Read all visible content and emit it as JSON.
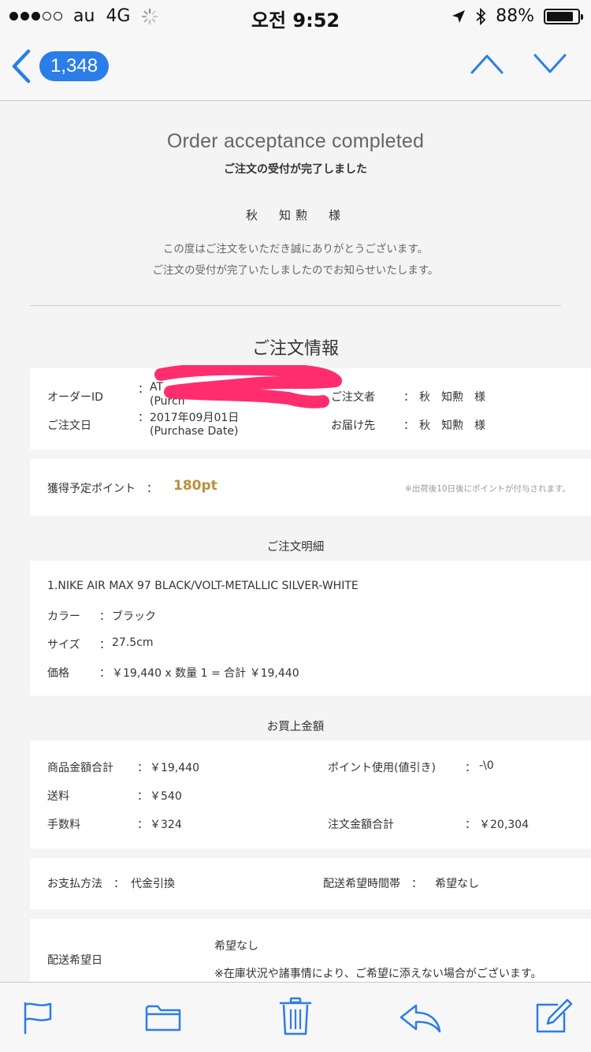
{
  "status_bar": {
    "carrier": "au",
    "network": "4G",
    "time": "오전 9:52",
    "battery": "88%",
    "battery_level": 0.88
  },
  "nav": {
    "back_icon": "chevron-left-icon",
    "unread_count": "1,348",
    "prev_icon": "chevron-up-icon",
    "next_icon": "chevron-down-icon"
  },
  "email": {
    "title_en": "Order acceptance completed",
    "title_jp": "ご注文の受付が完了しました",
    "customer": "秋　知勲　様",
    "thanks_line1": "この度はご注文をいただき誠にありがとうございます。",
    "thanks_line2": "ご注文の受付が完了いたしましたのでお知らせいたします。",
    "order_info_title": "ご注文情報",
    "order_info": {
      "order_id_label": "オーダーID",
      "order_id_value": "AT",
      "order_id_sub": "(Purch",
      "order_date_label": "ご注文日",
      "order_date_value": "2017年09月01日",
      "order_date_sub": "(Purchase Date)",
      "orderer_label": "ご注文者",
      "orderer_value": "秋　知勲　様",
      "delivery_label": "お届け先",
      "delivery_value": "秋　知勲　様",
      "colon": "："
    },
    "points": {
      "label": "獲得予定ポイント　：",
      "value": "180pt",
      "note": "※出荷後10日後にポイントが付与されます。"
    },
    "details_title": "ご注文明細",
    "item": {
      "name": "1.NIKE AIR MAX 97 BLACK/VOLT-METALLIC SILVER-WHITE",
      "color_label": "カラー",
      "color_value": "ブラック",
      "size_label": "サイズ",
      "size_value": "27.5cm",
      "price_label": "価格",
      "price_value": "￥19,440 x 数量 1 = 合計 ￥19,440"
    },
    "purchase_title": "お買上金額",
    "amounts": {
      "subtotal_label": "商品金額合計",
      "subtotal_value": "￥19,440",
      "shipping_label": "送料",
      "shipping_value": "￥540",
      "fee_label": "手数料",
      "fee_value": "￥324",
      "points_used_label": "ポイント使用(値引き)",
      "points_used_value": "-\\0",
      "total_label": "注文金額合計",
      "total_value": "￥20,304"
    },
    "payment": {
      "method_label": "お支払方法　：",
      "method_value": "代金引換",
      "time_label": "配送希望時間帯　：",
      "time_value": "希望なし"
    },
    "delivery_date": {
      "label": "配送希望日",
      "value": "希望なし",
      "note": "※在庫状況や諸事情により、ご希望に添えない場合がございます。"
    }
  },
  "toolbar": {
    "flag_icon": "flag-icon",
    "folder_icon": "folder-icon",
    "trash_icon": "trash-icon",
    "reply_icon": "reply-icon",
    "compose_icon": "compose-icon"
  },
  "colors": {
    "ios_blue": "#2b7de9",
    "points_gold": "#b8913a",
    "redaction": "#ff2d6e"
  }
}
